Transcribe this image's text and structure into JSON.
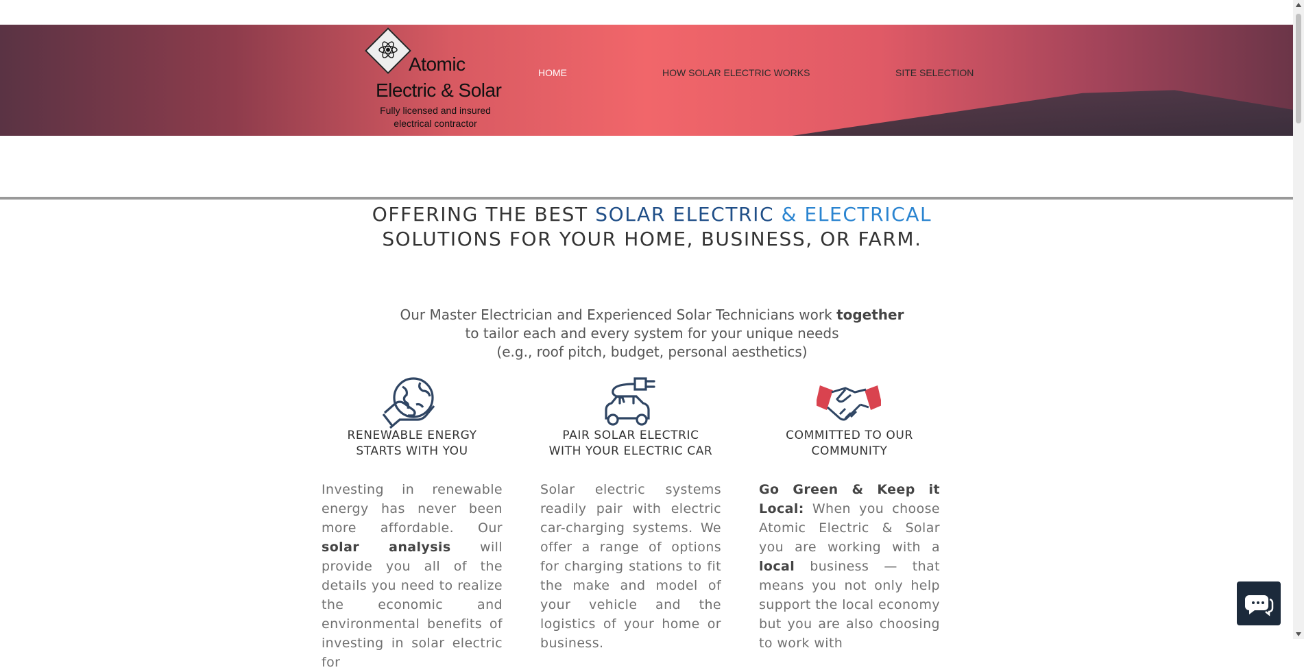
{
  "brand": {
    "name_line1": "Atomic",
    "name_line2": "Electric & Solar",
    "tagline_line1": "Fully licensed and insured",
    "tagline_line2": "electrical contractor",
    "logo_icon": "atom-diamond-icon"
  },
  "nav": {
    "items": [
      {
        "label": "HOME",
        "active": true
      },
      {
        "label": "HOW SOLAR ELECTRIC WORKS",
        "active": false
      },
      {
        "label": "SITE SELECTION",
        "active": false
      }
    ]
  },
  "headline": {
    "part1": "OFFERING THE BEST ",
    "part2": "SOLAR ELECTRIC",
    "part3": " & ELECTRICAL",
    "line2": "SOLUTIONS FOR YOUR HOME, BUSINESS, OR FARM."
  },
  "intro": {
    "line1_a": "Our Master Electrician and Experienced Solar Technicians work ",
    "line1_b": "together",
    "line2": "to tailor each and every system for your unique needs",
    "line3": "(e.g., roof pitch, budget, personal aesthetics)"
  },
  "features": [
    {
      "icon": "globe-in-hand-icon",
      "title_line1": "RENEWABLE ENERGY",
      "title_line2": "STARTS WITH YOU",
      "text_a": "Investing in renewable energy has never been more affordable. Our ",
      "text_b": "solar analysis",
      "text_c": " will provide you all of the details you need to realize the economic and environmental benefits of investing in solar electric for"
    },
    {
      "icon": "electric-car-plug-icon",
      "title_line1": "PAIR SOLAR ELECTRIC",
      "title_line2": "WITH YOUR ELECTRIC CAR",
      "text_a": "Solar electric systems readily pair with electric car-charging systems. We offer a range of options for charging stations to fit the make and model of your vehicle and the logistics of your home or business."
    },
    {
      "icon": "handshake-icon",
      "title_line1": "COMMITTED TO OUR",
      "title_line2": "COMMUNITY",
      "text_a": "Go Green & Keep it Local:",
      "text_b": " When you choose Atomic Electric & Solar you are working with a ",
      "text_c": "local",
      "text_d": " business — that means you not only help support the local economy but you are also choosing to work with"
    }
  ],
  "chat": {
    "icon": "chat-bubbles-icon"
  },
  "colors": {
    "accent_dark_blue": "#1f4e87",
    "accent_light_blue": "#2a84d0",
    "icon_navy": "#2f4563",
    "icon_red": "#d9434f"
  }
}
